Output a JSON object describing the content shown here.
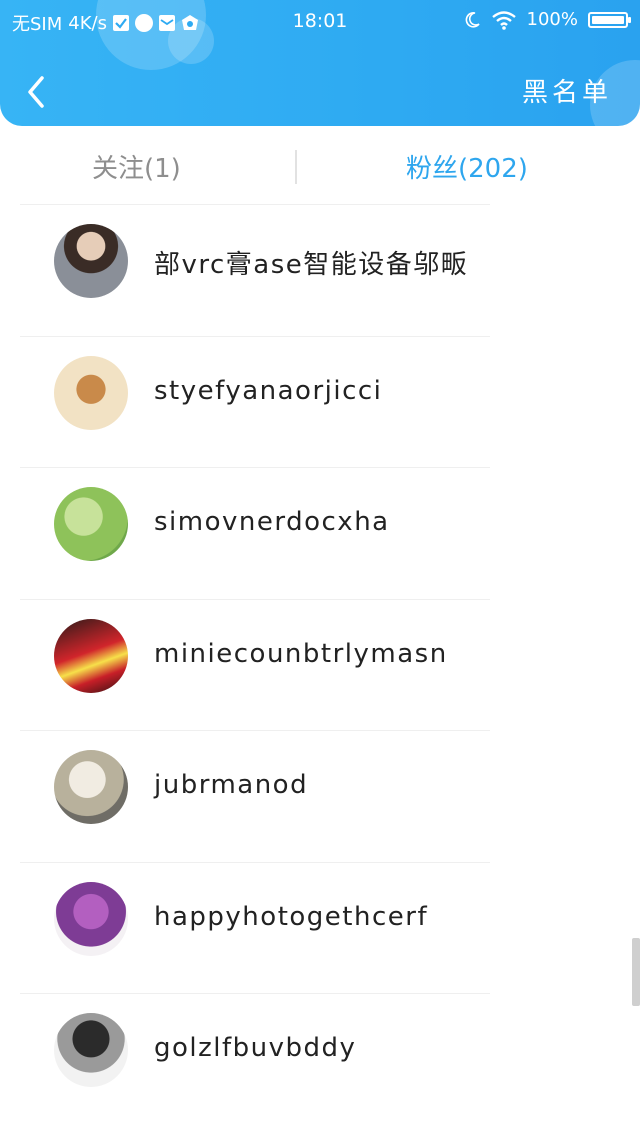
{
  "status_bar": {
    "carrier": "无SIM",
    "speed": "4K/s",
    "time": "18:01",
    "battery": "100%",
    "icons": [
      "check-icon",
      "paw-icon",
      "mail-icon",
      "shield-icon",
      "moon-icon",
      "wifi-icon",
      "battery-icon"
    ]
  },
  "header": {
    "back_icon": "chevron-left-icon",
    "blacklist_label": "黑名单",
    "accent_color": "#2eaaf2"
  },
  "tabs": [
    {
      "label": "关注(1)",
      "active": false
    },
    {
      "label": "粉丝(202)",
      "active": true
    }
  ],
  "fans": [
    {
      "name": "部vrc膏ase智能设备邬畈"
    },
    {
      "name": "styefyanaorjicci"
    },
    {
      "name": "simovnerdocxha"
    },
    {
      "name": "miniecounbtrlymasn"
    },
    {
      "name": "jubrmanod"
    },
    {
      "name": "happyhotogethcerf"
    },
    {
      "name": "golzlfbuvbddy"
    }
  ]
}
